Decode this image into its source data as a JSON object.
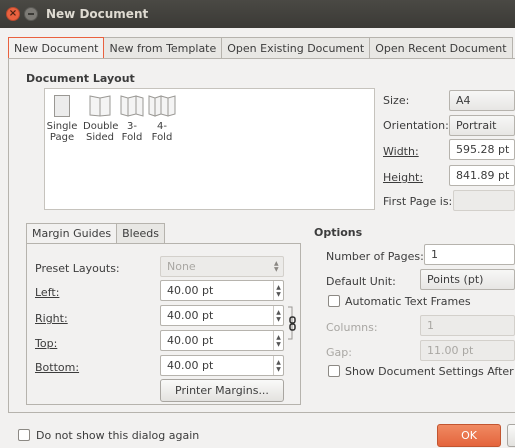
{
  "window": {
    "title": "New Document"
  },
  "tabs": [
    {
      "label": "New Document",
      "active": true
    },
    {
      "label": "New from Template",
      "active": false
    },
    {
      "label": "Open Existing Document",
      "active": false
    },
    {
      "label": "Open Recent Document",
      "active": false
    }
  ],
  "document_layout": {
    "title": "Document Layout",
    "items": [
      {
        "label_line1": "Single",
        "label_line2": "Page"
      },
      {
        "label_line1": "Double",
        "label_line2": "Sided"
      },
      {
        "label_line1": "3-",
        "label_line2": "Fold"
      },
      {
        "label_line1": "4-",
        "label_line2": "Fold"
      }
    ]
  },
  "page_settings": {
    "size_label": "Size:",
    "size_value": "A4",
    "orientation_label": "Orientation:",
    "orientation_value": "Portrait",
    "width_label": "Width:",
    "width_value": "595.28 pt",
    "height_label": "Height:",
    "height_value": "841.89 pt",
    "first_page_label": "First Page is:"
  },
  "margin_tabs": [
    {
      "label": "Margin Guides",
      "active": true
    },
    {
      "label": "Bleeds",
      "active": false
    }
  ],
  "margins": {
    "preset_label": "Preset Layouts:",
    "preset_value": "None",
    "left_label": "Left:",
    "left_value": "40.00 pt",
    "right_label": "Right:",
    "right_value": "40.00 pt",
    "top_label": "Top:",
    "top_value": "40.00 pt",
    "bottom_label": "Bottom:",
    "bottom_value": "40.00 pt",
    "printer_margins_label": "Printer Margins..."
  },
  "options": {
    "title": "Options",
    "num_pages_label": "Number of Pages:",
    "num_pages_value": "1",
    "default_unit_label": "Default Unit:",
    "default_unit_value": "Points (pt)",
    "auto_text_frames_label": "Automatic Text Frames",
    "columns_label": "Columns:",
    "columns_value": "1",
    "gap_label": "Gap:",
    "gap_value": "11.00 pt",
    "show_settings_label": "Show Document Settings After C"
  },
  "footer": {
    "dont_show_label": "Do not show this dialog again",
    "ok_label": "OK"
  },
  "colors": {
    "accent": "#e9613f",
    "titlebar": "#3b3a36",
    "background": "#f2f1f0"
  }
}
